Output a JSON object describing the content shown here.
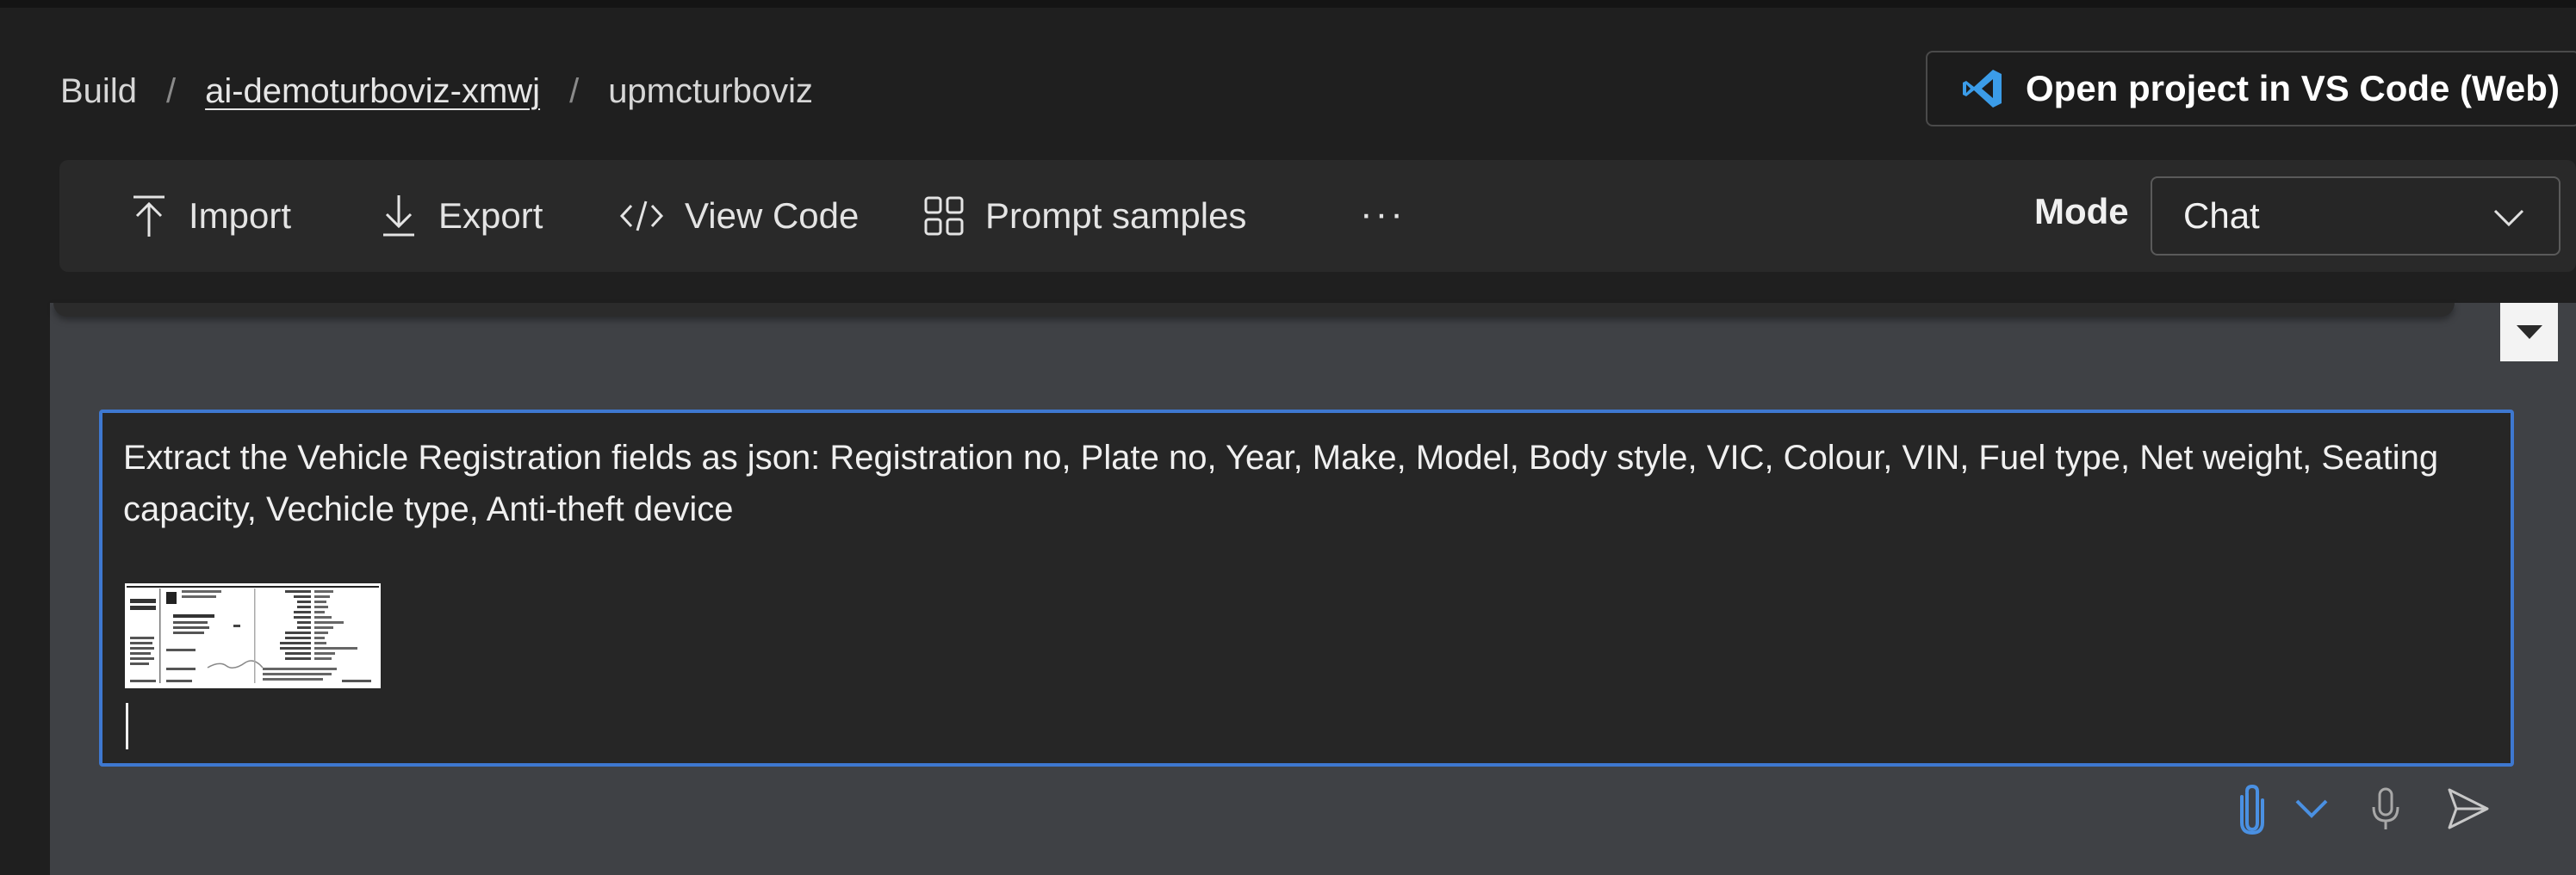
{
  "breadcrumb": {
    "root": "Build",
    "separator": "/",
    "project": "ai-demoturboviz-xmwj",
    "current": "upmcturboviz"
  },
  "header": {
    "vscode_button": "Open project in VS Code (Web)",
    "vscode_icon": "vscode-icon"
  },
  "toolbar": {
    "import": "Import",
    "export": "Export",
    "view_code": "View Code",
    "prompt_samples": "Prompt samples",
    "more": "···",
    "mode_label": "Mode",
    "mode_value": "Chat"
  },
  "chat": {
    "prompt": "Extract the Vehicle Registration fields as json: Registration no, Plate no, Year, Make, Model, Body style, VIC, Colour, VIN, Fuel type, Net weight, Seating capacity, Vechicle type, Anti-theft device",
    "attachment_icon": "document-thumbnail"
  },
  "colors": {
    "background": "#1f1f1f",
    "toolbar": "#292929",
    "chat_area": "#3f4145",
    "input_border": "#3e78d0",
    "accent_icon": "#4a90e2"
  },
  "icons": [
    "upload-icon",
    "download-icon",
    "code-icon",
    "grid-icon",
    "more-icon",
    "chevron-down-icon",
    "scroll-down-icon",
    "paperclip-icon",
    "microphone-icon",
    "send-icon"
  ]
}
